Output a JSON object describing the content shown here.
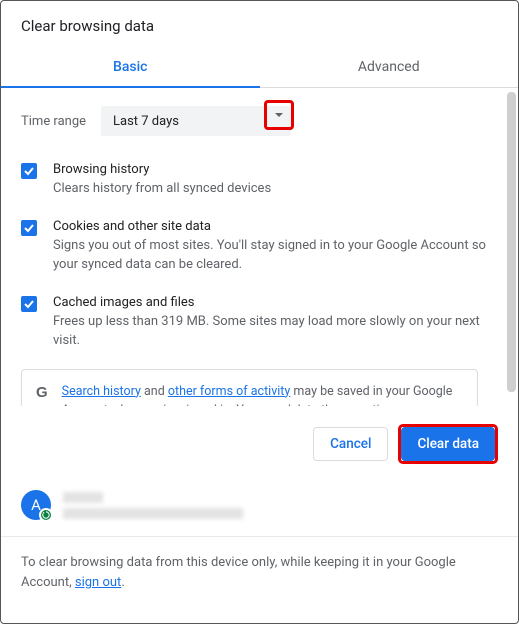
{
  "title": "Clear browsing data",
  "tabs": {
    "basic": "Basic",
    "advanced": "Advanced"
  },
  "time": {
    "label": "Time range",
    "selected": "Last 7 days"
  },
  "options": {
    "browsing": {
      "title": "Browsing history",
      "desc": "Clears history from all synced devices"
    },
    "cookies": {
      "title": "Cookies and other site data",
      "desc": "Signs you out of most sites. You'll stay signed in to your Google Account so your synced data can be cleared."
    },
    "cache": {
      "title": "Cached images and files",
      "desc": "Frees up less than 319 MB. Some sites may load more slowly on your next visit."
    }
  },
  "notice": {
    "link1": "Search history",
    "mid1": " and ",
    "link2": "other forms of activity",
    "rest": " may be saved in your Google Account when you're signed in. You can delete them anytime."
  },
  "buttons": {
    "cancel": "Cancel",
    "clear": "Clear data"
  },
  "avatar_letter": "A",
  "footer": {
    "pre": "To clear browsing data from this device only, while keeping it in your Google Account, ",
    "link": "sign out",
    "post": "."
  }
}
